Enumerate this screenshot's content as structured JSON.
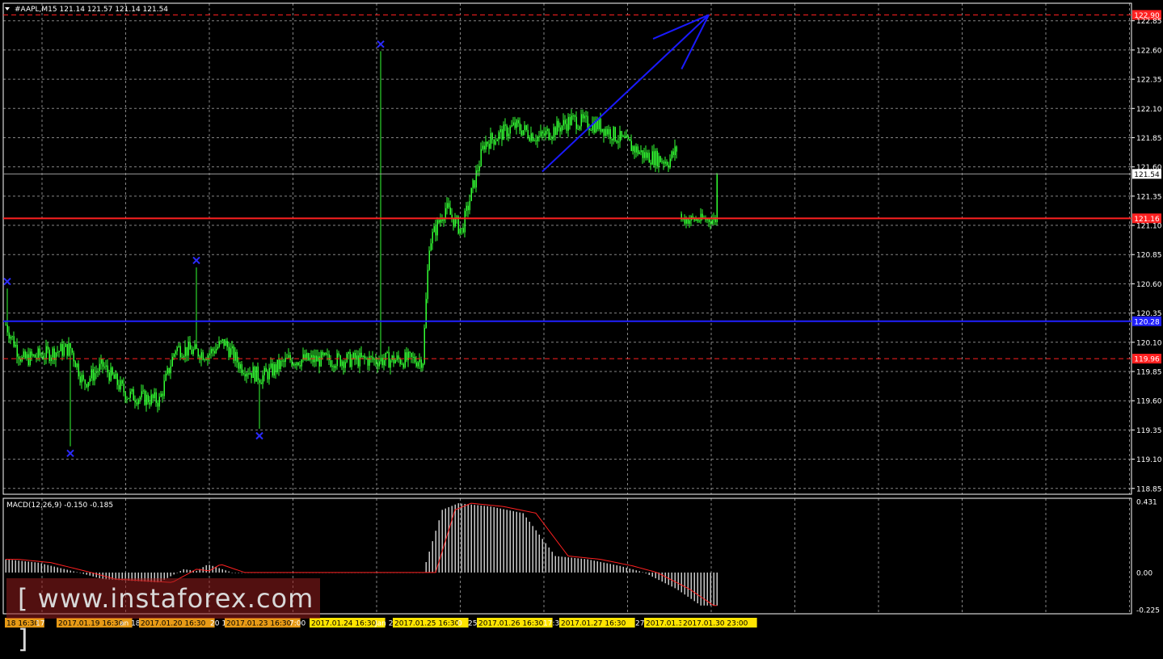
{
  "chart_data": {
    "type": "candlestick",
    "symbol_header": "#AAPL,M15  121.14 121.57 121.14 121.54",
    "indicator_header": "MACD(12,26,9) -0.150 -0.185",
    "price_axis_labels": [
      "122.85",
      "122.60",
      "122.35",
      "122.10",
      "121.85",
      "121.60",
      "121.35",
      "121.10",
      "120.85",
      "120.60",
      "120.35",
      "120.10",
      "119.85",
      "119.60",
      "119.35",
      "119.10",
      "118.85"
    ],
    "price_ylim": [
      118.8,
      123.0
    ],
    "macd_axis_labels": [
      "0.431",
      "0.00",
      "-0.225"
    ],
    "macd_ylim": [
      -0.25,
      0.45
    ],
    "current_price": 121.54,
    "current_price_label": "121.54",
    "levels": [
      {
        "value": 122.9,
        "label": "122.90",
        "style": "dashed",
        "color": "#ff2020"
      },
      {
        "value": 121.16,
        "label": "121.16",
        "style": "solid",
        "color": "#ff2020"
      },
      {
        "value": 120.28,
        "label": "120.28",
        "style": "solid",
        "color": "#2020ff"
      },
      {
        "value": 119.96,
        "label": "119.96",
        "style": "dashed",
        "color": "#ff2020"
      }
    ],
    "fractal_markers": [
      {
        "bar": 1,
        "price": 120.62
      },
      {
        "bar": 40,
        "price": 119.15
      },
      {
        "bar": 118,
        "price": 120.8
      },
      {
        "bar": 157,
        "price": 119.3
      },
      {
        "bar": 232,
        "price": 122.65
      }
    ],
    "trend_arrow": {
      "from_bar": 332,
      "from_price": 121.56,
      "to_bar": 435,
      "to_price": 122.9,
      "color": "#1a1aff"
    },
    "time_labels": [
      {
        "text": "18 16:30",
        "hl": "orange"
      },
      {
        "text": "17",
        "hl": "none"
      },
      {
        "text": "2017.01.19 16:30",
        "hl": "orange"
      },
      {
        "text": "an 18",
        "hl": "none"
      },
      {
        "text": "2017.01.20 16:30",
        "hl": "orange"
      },
      {
        "text": "20 1",
        "hl": "none"
      },
      {
        "text": "2017.01.23 16:30",
        "hl": "orange"
      },
      {
        "text": "7:00",
        "hl": "none"
      },
      {
        "text": "2017.01.24 16:30",
        "hl": "yellow"
      },
      {
        "text": "Jan 2",
        "hl": "none"
      },
      {
        "text": "2017.01.25 16:30",
        "hl": "yellow"
      },
      {
        "text": "0",
        "hl": "none"
      },
      {
        "text": "25",
        "hl": "none"
      },
      {
        "text": "2017.01.26 16:30",
        "hl": "yellow"
      },
      {
        "text": "17:3",
        "hl": "none"
      },
      {
        "text": "2017.01.27 16:30",
        "hl": "yellow"
      },
      {
        "text": "27 Jan",
        "hl": "none"
      },
      {
        "text": "2017.01.3",
        "hl": "yellow"
      },
      {
        "text": "2017.01.30 23:00",
        "hl": "yellow"
      }
    ],
    "colors": {
      "candle": "#33ff33",
      "grid": "#bcbcbc",
      "axis": "#ffffff",
      "macd_hist": "#c8c8c8",
      "macd_signal": "#ff2020",
      "marker": "#2a2aff"
    }
  },
  "watermark": "[ www.instaforex.com ]"
}
